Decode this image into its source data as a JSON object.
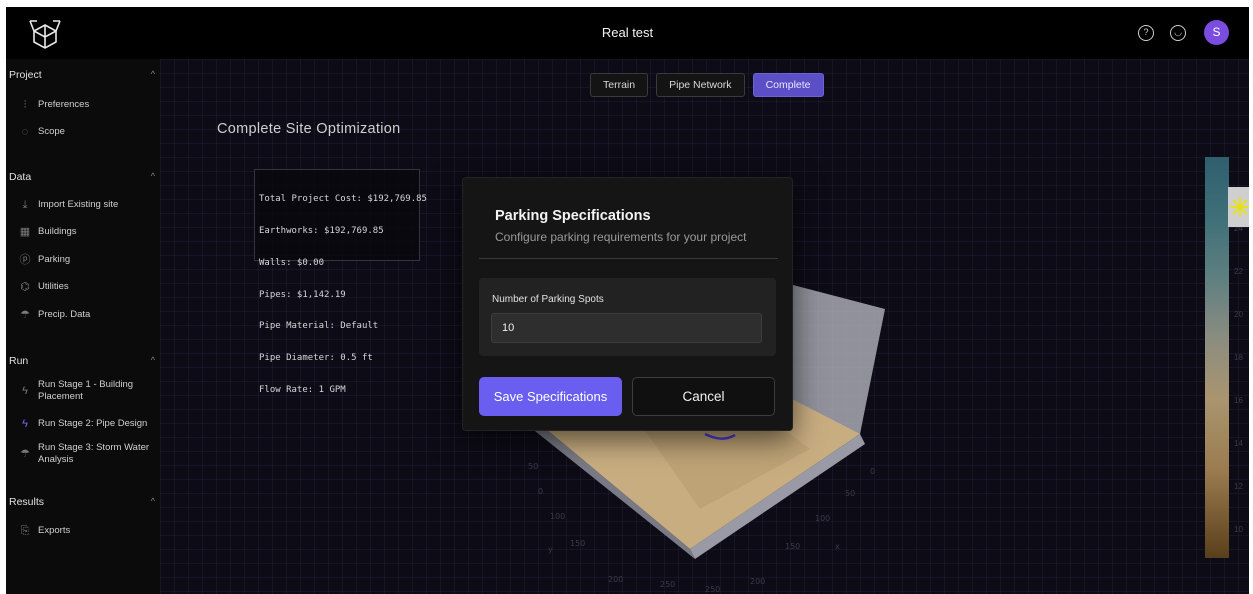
{
  "header": {
    "title": "Real test",
    "avatar_letter": "S"
  },
  "sidebar": {
    "sections": [
      {
        "title": "Project",
        "items": [
          {
            "label": "Preferences",
            "icon": "sliders-icon"
          },
          {
            "label": "Scope",
            "icon": "crosshair-icon"
          }
        ]
      },
      {
        "title": "Data",
        "items": [
          {
            "label": "Import Existing site",
            "icon": "download-icon"
          },
          {
            "label": "Buildings",
            "icon": "building-icon"
          },
          {
            "label": "Parking",
            "icon": "parking-icon"
          },
          {
            "label": "Utilities",
            "icon": "utilities-icon"
          },
          {
            "label": "Precip. Data",
            "icon": "umbrella-icon"
          }
        ]
      },
      {
        "title": "Run",
        "items": [
          {
            "label": "Run Stage 1 - Building Placement",
            "icon": "zap-icon"
          },
          {
            "label": "Run Stage 2: Pipe Design",
            "icon": "zap-icon"
          },
          {
            "label": "Run Stage 3: Storm Water Analysis",
            "icon": "umbrella-icon"
          }
        ]
      },
      {
        "title": "Results",
        "items": [
          {
            "label": "Exports",
            "icon": "export-icon"
          }
        ]
      }
    ]
  },
  "main": {
    "tabs": [
      {
        "label": "Terrain",
        "active": false
      },
      {
        "label": "Pipe Network",
        "active": false
      },
      {
        "label": "Complete",
        "active": true
      }
    ],
    "title": "Complete Site Optimization",
    "summary": [
      "Total Project Cost: $192,769.85",
      "Earthworks: $192,769.85",
      "Walls: $0.00",
      "Pipes: $1,142.19",
      "Pipe Material: Default",
      "Pipe Diameter: 0.5 ft",
      "Flow Rate: 1 GPM"
    ],
    "colorbar_ticks": [
      "24",
      "22",
      "20",
      "18",
      "16",
      "14",
      "12",
      "10"
    ],
    "axis_ticks": {
      "x": [
        "0",
        "50",
        "100",
        "150",
        "200",
        "250"
      ],
      "y": [
        "0",
        "50",
        "100",
        "150",
        "200",
        "250"
      ],
      "x_label": "x",
      "y_label": "y"
    }
  },
  "modal": {
    "title": "Parking Specifications",
    "subtitle": "Configure parking requirements for your project",
    "field_label": "Number of Parking Spots",
    "field_value": "10",
    "save_label": "Save Specifications",
    "cancel_label": "Cancel"
  },
  "colors": {
    "accent": "#6a5ef0",
    "active_tab": "#5a4fc7",
    "avatar": "#7b4ce0"
  }
}
